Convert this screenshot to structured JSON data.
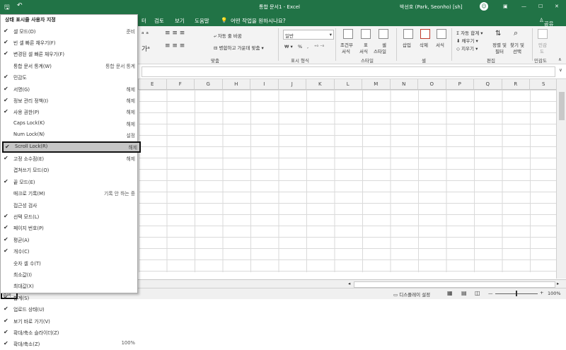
{
  "titlebar": {
    "doc_title": "통합 문서1  -  Excel",
    "user": "박선호 (Park, Seonho) [sh]",
    "minimize": "—",
    "maximize": "☐",
    "close": "✕"
  },
  "tabs": {
    "partial": "터",
    "review": "검토",
    "view": "보기",
    "help": "도움말",
    "tellme": "어떤 작업을 원하시나요?",
    "share": "공유"
  },
  "ribbon": {
    "wrap_text": "자동 줄 바꿈",
    "merge_center": "병합하고 가운데 맞춤",
    "alignment_group": "맞춤",
    "number_format": "일반",
    "number_group": "표시 형식",
    "conditional_format": "조건부",
    "conditional_format2": "서식",
    "format_table": "표",
    "format_table2": "서식",
    "cell_styles": "셀",
    "cell_styles2": "스타일",
    "styles_group": "스타일",
    "insert": "삽입",
    "delete": "삭제",
    "format": "서식",
    "cells_group": "셀",
    "autosum": "자동 합계",
    "fill": "채우기",
    "clear": "지우기",
    "sort_filter": "정렬 및",
    "sort_filter2": "필터",
    "find_select": "찾기 및",
    "find_select2": "선택",
    "editing_group": "편집",
    "sensitivity": "민감",
    "sensitivity2": "도",
    "sensitivity_group": "민감도",
    "percent": "%"
  },
  "columns": [
    "E",
    "F",
    "G",
    "H",
    "I",
    "J",
    "K",
    "L",
    "M",
    "N",
    "O",
    "P",
    "Q",
    "R",
    "S"
  ],
  "menu": {
    "title": "상태 표시줄 사용자 지정",
    "items": [
      {
        "check": "✔",
        "label": "셀 모드(D)",
        "value": "준비"
      },
      {
        "check": "✔",
        "label": "빈 셀 빠른 채우기(F)",
        "value": ""
      },
      {
        "check": "✔",
        "label": "변경된 셀 빠른 채우기(F)",
        "value": ""
      },
      {
        "check": "",
        "label": "통합 문서 통계(W)",
        "value": "통합 문서 통계"
      },
      {
        "check": "✔",
        "label": "민감도",
        "value": ""
      },
      {
        "check": "✔",
        "label": "서명(G)",
        "value": "해제"
      },
      {
        "check": "✔",
        "label": "정보 관리 정책(I)",
        "value": "해제"
      },
      {
        "check": "✔",
        "label": "사용 권한(P)",
        "value": "해제"
      },
      {
        "check": "",
        "label": "Caps Lock(K)",
        "value": "해제"
      },
      {
        "check": "",
        "label": "Num Lock(N)",
        "value": "설정"
      },
      {
        "check": "✔",
        "label": "Scroll Lock(R)",
        "value": "해제"
      },
      {
        "check": "✔",
        "label": "고정 소수점(E)",
        "value": "해제"
      },
      {
        "check": "",
        "label": "겹쳐쓰기 모드(O)",
        "value": ""
      },
      {
        "check": "✔",
        "label": "끝 모드(E)",
        "value": ""
      },
      {
        "check": "",
        "label": "매크로 기록(M)",
        "value": "기록 안 하는 중"
      },
      {
        "check": "",
        "label": "접근성 검사",
        "value": ""
      },
      {
        "check": "✔",
        "label": "선택 모드(L)",
        "value": ""
      },
      {
        "check": "✔",
        "label": "페이지 번호(P)",
        "value": ""
      },
      {
        "check": "✔",
        "label": "평균(A)",
        "value": ""
      },
      {
        "check": "✔",
        "label": "개수(C)",
        "value": ""
      },
      {
        "check": "",
        "label": "숫자 셀 수(T)",
        "value": ""
      },
      {
        "check": "",
        "label": "최소값(I)",
        "value": ""
      },
      {
        "check": "",
        "label": "최대값(X)",
        "value": ""
      },
      {
        "check": "✔",
        "label": "합계(S)",
        "value": ""
      },
      {
        "check": "✔",
        "label": "업로드 상태(U)",
        "value": ""
      },
      {
        "check": "✔",
        "label": "보기 바로 가기(V)",
        "value": ""
      },
      {
        "check": "✔",
        "label": "확대/축소 슬라이더(Z)",
        "value": ""
      },
      {
        "check": "✔",
        "label": "확대/축소(Z)",
        "value": "100%"
      }
    ]
  },
  "statusbar": {
    "mode_truncated": "준비...",
    "display_settings": "디스플레이 설정",
    "zoom_minus": "—",
    "zoom_plus": "+",
    "zoom_value": "100%"
  },
  "colors": {
    "excel_green": "#217346",
    "menu_highlight": "#c6c6c6"
  }
}
